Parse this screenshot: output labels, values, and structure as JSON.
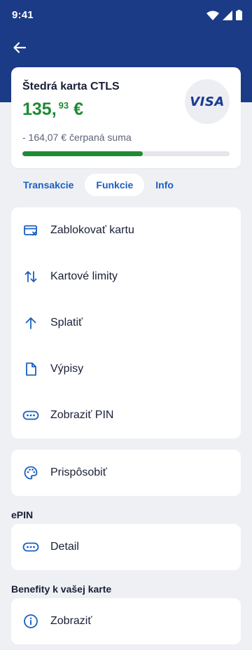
{
  "status": {
    "time": "9:41"
  },
  "card": {
    "title": "Štedrá karta CTLS",
    "balance_main": "135,",
    "balance_cents": "93",
    "currency": "€",
    "brand": "VISA",
    "drawn_text": "- 164,07 € čerpaná suma",
    "progress_fraction": 0.58,
    "progress_color": "#1e8b35"
  },
  "tabs": [
    {
      "label": "Transakcie",
      "active": false
    },
    {
      "label": "Funkcie",
      "active": true
    },
    {
      "label": "Info",
      "active": false
    }
  ],
  "functions": [
    {
      "label": "Zablokovať kartu",
      "icon": "card-block-icon"
    },
    {
      "label": "Kartové limity",
      "icon": "swap-vertical-icon"
    },
    {
      "label": "Splatiť",
      "icon": "arrow-up-icon"
    },
    {
      "label": "Výpisy",
      "icon": "document-icon"
    },
    {
      "label": "Zobraziť PIN",
      "icon": "pin-dots-icon"
    }
  ],
  "customize": {
    "label": "Prispôsobiť",
    "icon": "palette-icon"
  },
  "epin": {
    "heading": "ePIN",
    "label": "Detail",
    "icon": "pin-dots-icon"
  },
  "benefits": {
    "heading": "Benefity k vašej karte",
    "label": "Zobraziť",
    "icon": "info-icon"
  },
  "colors": {
    "header": "#1b3b86",
    "accent": "#1a5fc2",
    "positive": "#1e8b35"
  }
}
